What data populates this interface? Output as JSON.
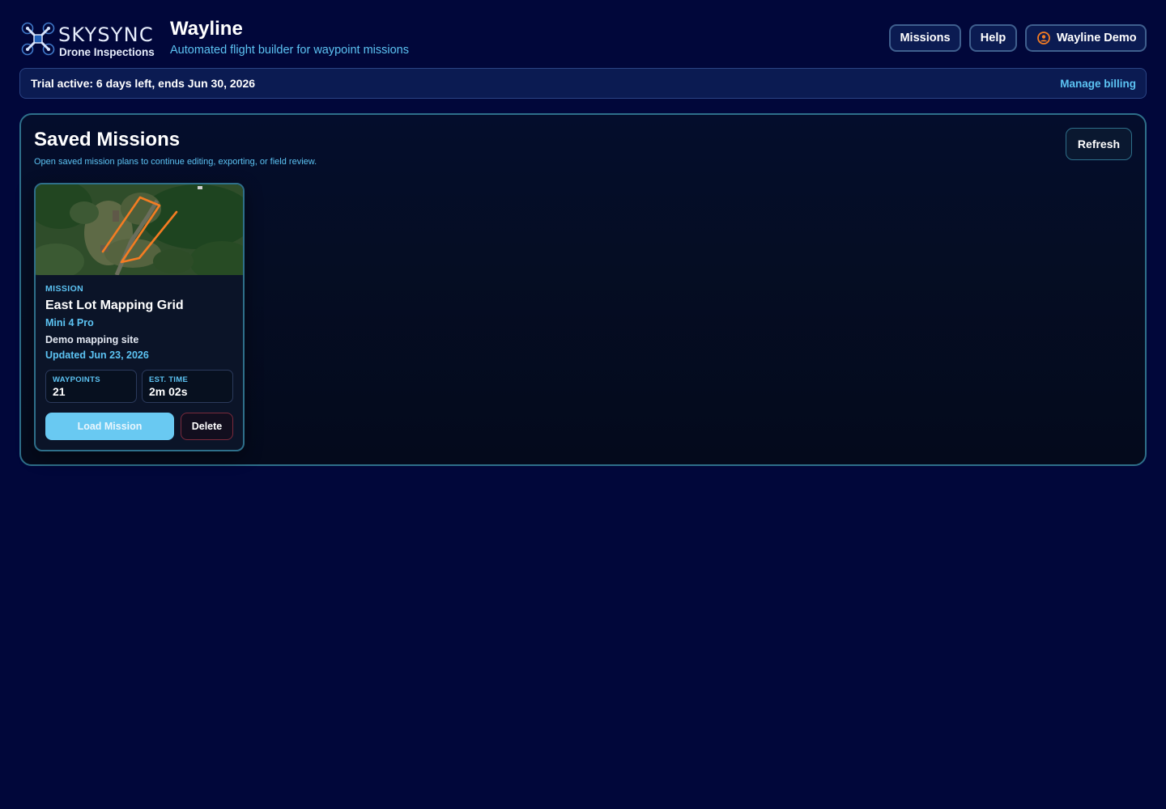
{
  "brand": {
    "logo_word": "SKYSYNC",
    "logo_sub": "Drone Inspections",
    "app_title": "Wayline",
    "app_subtitle": "Automated flight builder for waypoint missions"
  },
  "nav": {
    "missions_label": "Missions",
    "help_label": "Help",
    "user_label": "Wayline Demo"
  },
  "trial": {
    "text": "Trial active: 6 days left, ends Jun 30, 2026",
    "link_label": "Manage billing"
  },
  "panel": {
    "title": "Saved Missions",
    "subtitle": "Open saved mission plans to continue editing, exporting, or field review.",
    "refresh_label": "Refresh"
  },
  "missions": [
    {
      "kicker": "MISSION",
      "name": "East Lot Mapping Grid",
      "drone": "Mini 4 Pro",
      "site": "Demo mapping site",
      "updated": "Updated Jun 23, 2026",
      "waypoints_label": "WAYPOINTS",
      "waypoints": "21",
      "time_label": "EST. TIME",
      "time": "2m 02s",
      "load_label": "Load Mission",
      "delete_label": "Delete"
    }
  ],
  "colors": {
    "background": "#01073a",
    "accent": "#5cc3f3",
    "panel_border": "#2e6f8a",
    "flight_path": "#f47c22",
    "danger_border": "#7a2a3c"
  },
  "icons": {
    "logo": "drone-icon",
    "user": "user-avatar-icon"
  }
}
